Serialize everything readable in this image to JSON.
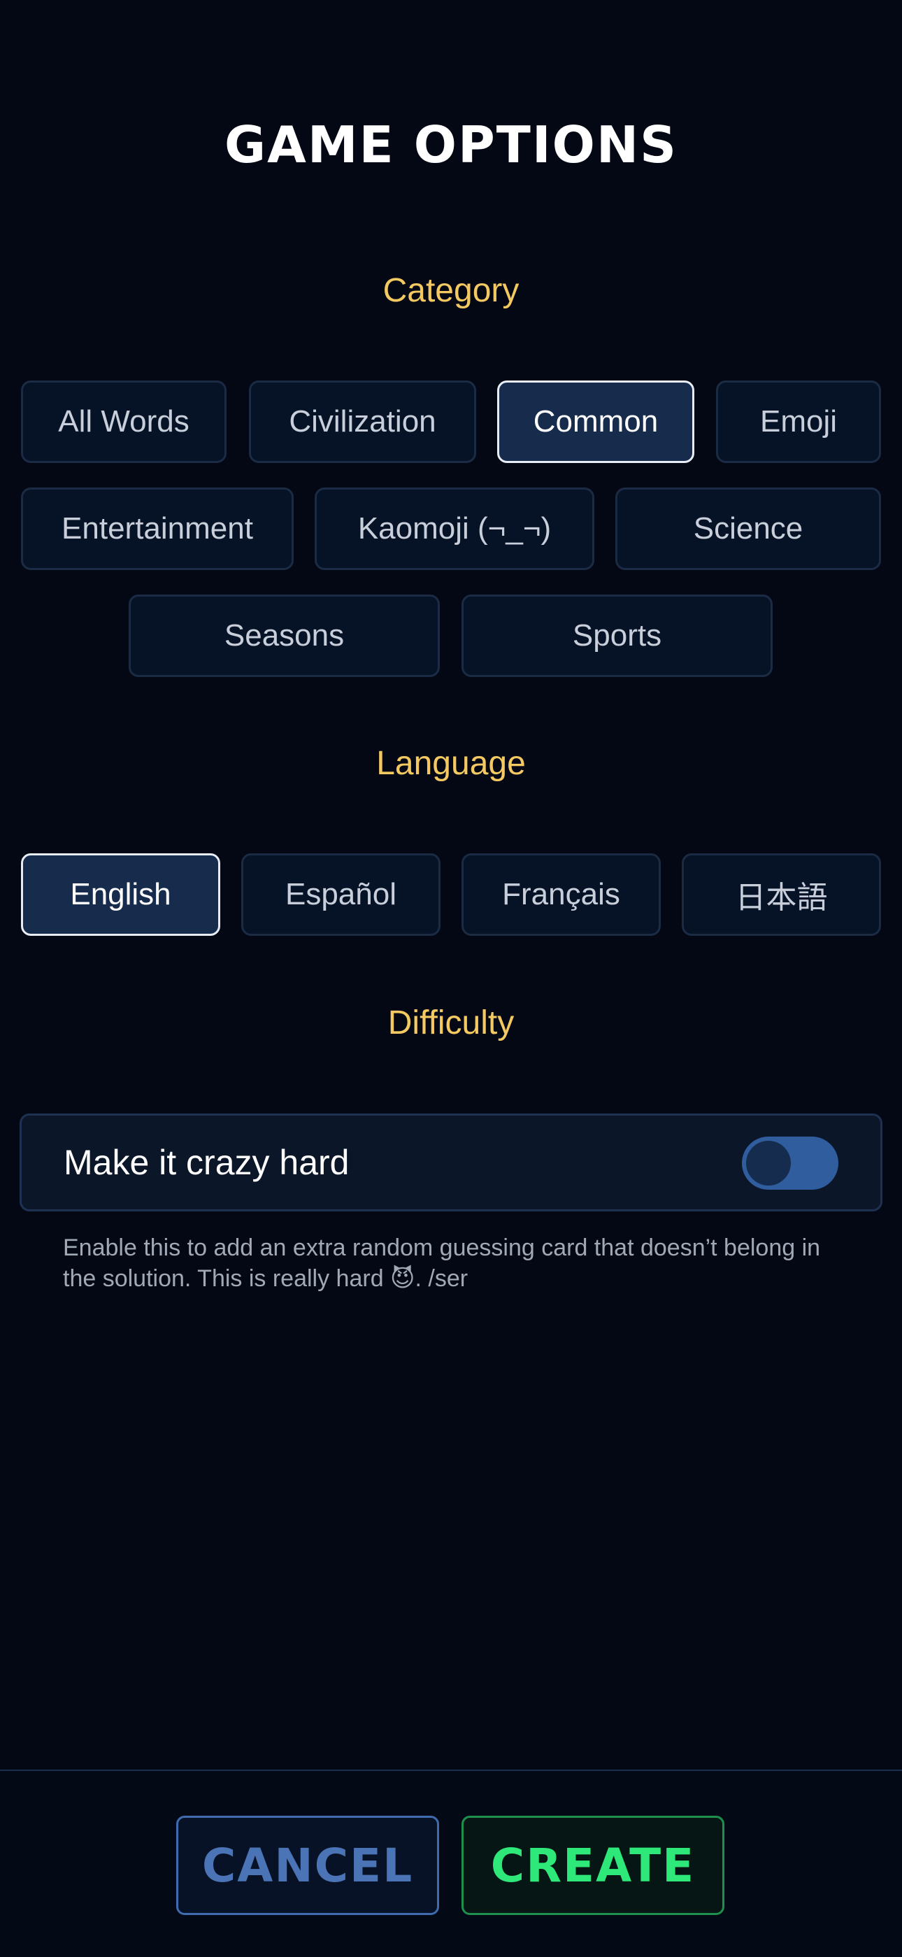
{
  "page": {
    "title": "GAME OPTIONS"
  },
  "category": {
    "heading": "Category",
    "options": [
      "All Words",
      "Civilization",
      "Common",
      "Emoji",
      "Entertainment",
      "Kaomoji (¬_¬)",
      "Science",
      "Seasons",
      "Sports"
    ],
    "selected": "Common"
  },
  "language": {
    "heading": "Language",
    "options": [
      "English",
      "Español",
      "Français",
      "日本語"
    ],
    "selected": "English"
  },
  "difficulty": {
    "heading": "Difficulty",
    "toggle_label": "Make it crazy hard",
    "toggle_on": false,
    "helper_text": "Enable this to add an extra random guessing card that doesn’t belong in the solution. This is really hard 😈. /ser"
  },
  "footer": {
    "cancel_label": "CANCEL",
    "create_label": "CREATE"
  },
  "colors": {
    "background": "#040814",
    "heading_accent": "#f5c962",
    "selected_chip": "#172c4d",
    "cancel_accent": "#4b74b6",
    "create_accent": "#2ee87a"
  }
}
